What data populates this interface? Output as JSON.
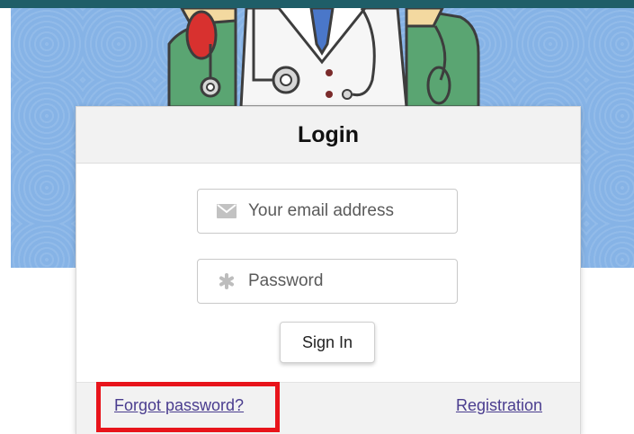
{
  "header": {
    "bar_color": "#1f5e68"
  },
  "hero": {
    "background_color": "#86b3e6",
    "illustration": "doctor-illustration"
  },
  "login": {
    "title": "Login",
    "email": {
      "placeholder": "Your email address",
      "value": "",
      "icon": "envelope-icon"
    },
    "password": {
      "placeholder": "Password",
      "value": "",
      "icon": "asterisk-icon"
    },
    "sign_in_label": "Sign In",
    "forgot_password_label": "Forgot password?",
    "registration_label": "Registration"
  },
  "annotation": {
    "highlight_color": "#e8141b"
  }
}
